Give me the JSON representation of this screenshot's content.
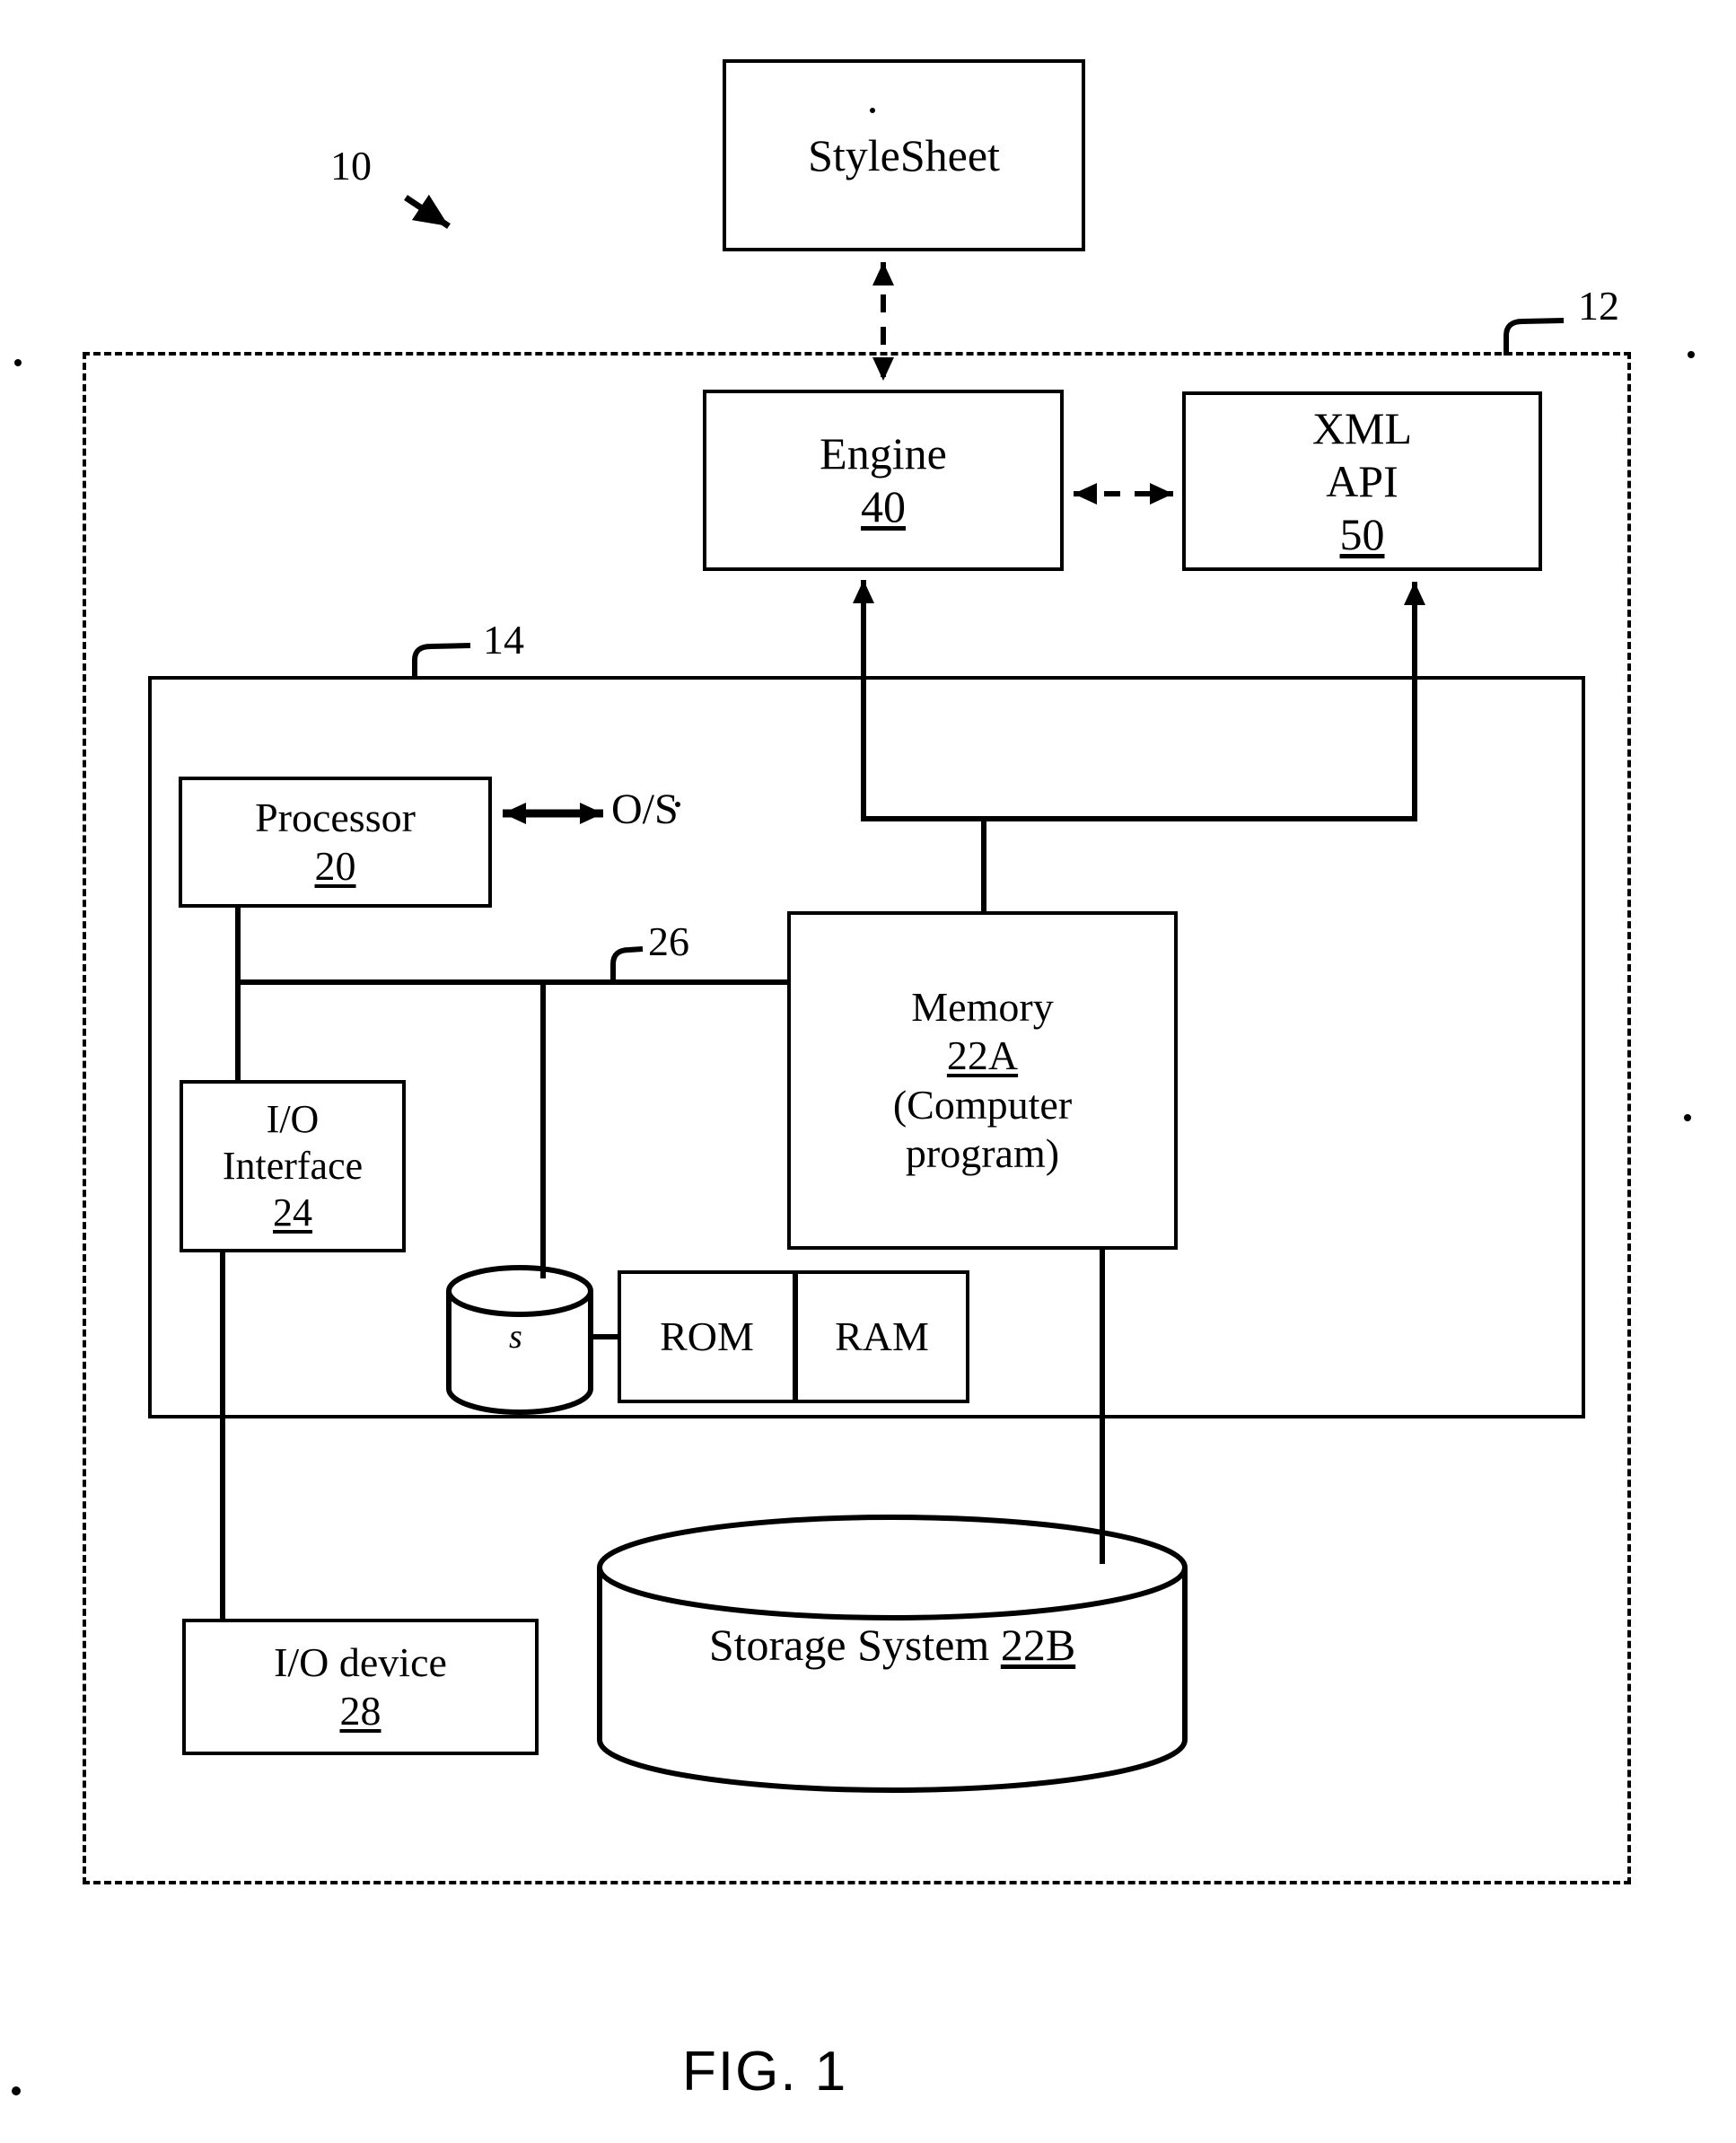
{
  "figure": {
    "caption": "FIG. 1",
    "system_ref": "10",
    "computer_system_ref": "12",
    "computing_device_ref": "14",
    "bus_ref": "26"
  },
  "blocks": {
    "stylesheet": {
      "title": "StyleSheet"
    },
    "engine": {
      "title": "Engine",
      "ref": "40"
    },
    "xml_api": {
      "line1": "XML",
      "line2": "API",
      "ref": "50"
    },
    "processor": {
      "title": "Processor",
      "ref": "20"
    },
    "os_label": "O/S",
    "memory": {
      "line1": "Memory",
      "ref": "22A",
      "line3": "(Computer",
      "line4": "program)"
    },
    "io_interface": {
      "line1": "I/O",
      "line2": "Interface",
      "ref": "24"
    },
    "disk_small": {
      "label": "s"
    },
    "rom": {
      "label": "ROM"
    },
    "ram": {
      "label": "RAM"
    },
    "io_device": {
      "title": "I/O device",
      "ref": "28"
    },
    "storage_system": {
      "title": "Storage System",
      "ref": "22B"
    }
  },
  "colors": {
    "ink": "#000000",
    "paper": "#ffffff"
  }
}
